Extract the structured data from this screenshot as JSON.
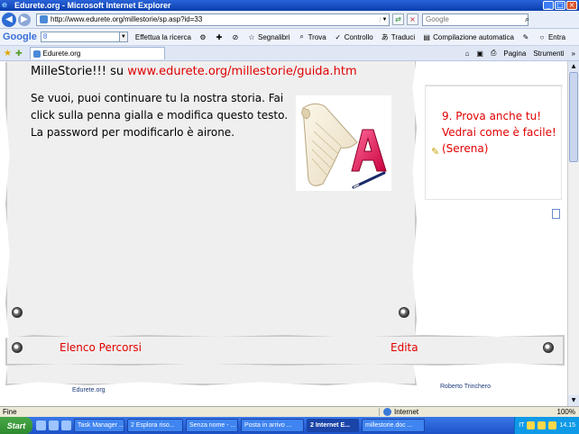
{
  "window": {
    "title": "Edurete.org - Microsoft Internet Explorer",
    "minimize": "_",
    "maximize": "□",
    "close": "×"
  },
  "address_bar": {
    "url": "http://www.edurete.org/millestorie/sp.asp?id=33",
    "search_placeholder": "Google"
  },
  "google_toolbar": {
    "logo": "Google",
    "search_prefix": "8",
    "items": [
      {
        "label": "Effettua la ricerca"
      },
      {
        "label": ""
      },
      {
        "label": ""
      },
      {
        "label": ""
      },
      {
        "label": "Segnalibri"
      },
      {
        "label": "Trova"
      },
      {
        "label": "Controllo"
      },
      {
        "label": "Traduci"
      },
      {
        "label": "Compilazione automatica"
      },
      {
        "label": ""
      },
      {
        "label": "Entra"
      }
    ]
  },
  "tabs": {
    "active_tab": "Edurete.org",
    "tools": [
      "Pagina",
      "Strumenti"
    ]
  },
  "story": {
    "title_prefix": "MilleStorie!!! su",
    "title_link": "www.edurete.org/millestorie/guida.htm",
    "body": "Se vuoi, puoi continuare tu la nostra storia. Fai click sulla penna gialla e modifica questo testo. La password per modificarlo è airone."
  },
  "side": {
    "message": "9. Prova anche tu! Vedrai come è facile! (Serena)"
  },
  "bottom": {
    "link_left": "Elenco Percorsi",
    "link_right": "Edita"
  },
  "footer": {
    "left": "Edurete.org",
    "right": "Roberto Trinchero"
  },
  "statusbar": {
    "text": "Fine",
    "zone": "Internet",
    "zoom": "100%"
  },
  "taskbar": {
    "start": "Start",
    "tasks": [
      {
        "label": "Task Manager ...",
        "active": false
      },
      {
        "label": "2 Esplora riso...",
        "active": false
      },
      {
        "label": "Senza nome - ...",
        "active": false
      },
      {
        "label": "Posta in arrivo ...",
        "active": false
      },
      {
        "label": "2 Internet E...",
        "active": true
      },
      {
        "label": "millestorie.doc ...",
        "active": false
      }
    ],
    "lang": "IT",
    "clock": "14.15"
  },
  "colors": {
    "link_red": "#e00000",
    "titlebar_blue": "#0a3fae",
    "paper": "#f0efef"
  }
}
